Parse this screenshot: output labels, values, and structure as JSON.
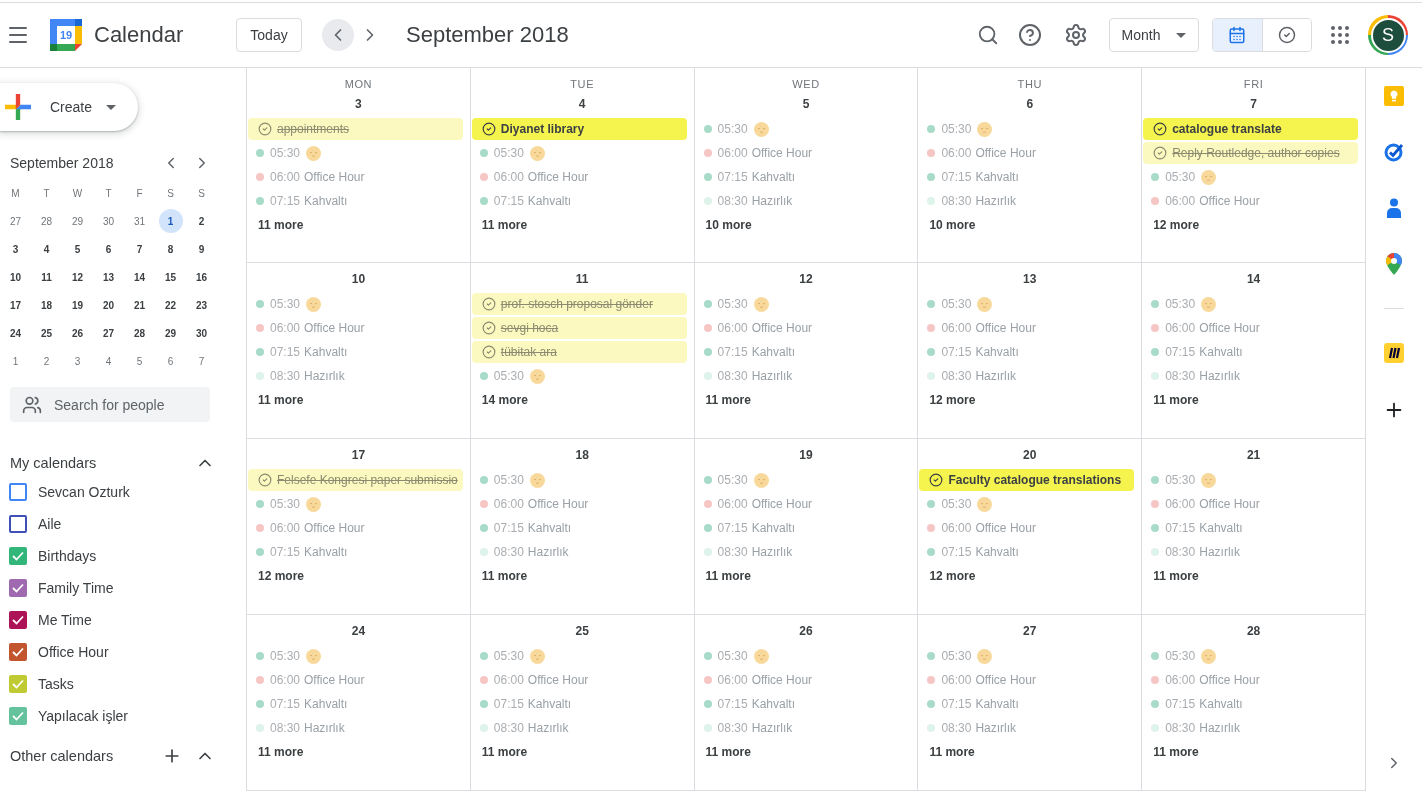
{
  "header": {
    "logo_text": "19",
    "app_name": "Calendar",
    "today_button": "Today",
    "nav": [
      {
        "kind": "prev",
        "hovered": true
      },
      {
        "kind": "next",
        "hovered": false
      }
    ],
    "title": "September 2018",
    "view_select": "Month",
    "view_toggle": [
      {
        "kind": "calendar",
        "selected": true
      },
      {
        "kind": "tasks",
        "selected": false
      }
    ],
    "avatar": "S"
  },
  "sidebar": {
    "create_button": "Create",
    "mini_calendar": {
      "title": "September 2018",
      "weekdays": [
        "M",
        "T",
        "W",
        "T",
        "F",
        "S",
        "S"
      ],
      "weeks": [
        [
          {
            "label": "27",
            "outside": true,
            "selected": false
          },
          {
            "label": "28",
            "outside": true,
            "selected": false
          },
          {
            "label": "29",
            "outside": true,
            "selected": false
          },
          {
            "label": "30",
            "outside": true,
            "selected": false
          },
          {
            "label": "31",
            "outside": true,
            "selected": false
          },
          {
            "label": "1",
            "outside": false,
            "selected": true
          },
          {
            "label": "2",
            "outside": false,
            "selected": false
          }
        ],
        [
          {
            "label": "3",
            "outside": false,
            "selected": false
          },
          {
            "label": "4",
            "outside": false,
            "selected": false
          },
          {
            "label": "5",
            "outside": false,
            "selected": false
          },
          {
            "label": "6",
            "outside": false,
            "selected": false
          },
          {
            "label": "7",
            "outside": false,
            "selected": false
          },
          {
            "label": "8",
            "outside": false,
            "selected": false
          },
          {
            "label": "9",
            "outside": false,
            "selected": false
          }
        ],
        [
          {
            "label": "10",
            "outside": false,
            "selected": false
          },
          {
            "label": "11",
            "outside": false,
            "selected": false
          },
          {
            "label": "12",
            "outside": false,
            "selected": false
          },
          {
            "label": "13",
            "outside": false,
            "selected": false
          },
          {
            "label": "14",
            "outside": false,
            "selected": false
          },
          {
            "label": "15",
            "outside": false,
            "selected": false
          },
          {
            "label": "16",
            "outside": false,
            "selected": false
          }
        ],
        [
          {
            "label": "17",
            "outside": false,
            "selected": false
          },
          {
            "label": "18",
            "outside": false,
            "selected": false
          },
          {
            "label": "19",
            "outside": false,
            "selected": false
          },
          {
            "label": "20",
            "outside": false,
            "selected": false
          },
          {
            "label": "21",
            "outside": false,
            "selected": false
          },
          {
            "label": "22",
            "outside": false,
            "selected": false
          },
          {
            "label": "23",
            "outside": false,
            "selected": false
          }
        ],
        [
          {
            "label": "24",
            "outside": false,
            "selected": false
          },
          {
            "label": "25",
            "outside": false,
            "selected": false
          },
          {
            "label": "26",
            "outside": false,
            "selected": false
          },
          {
            "label": "27",
            "outside": false,
            "selected": false
          },
          {
            "label": "28",
            "outside": false,
            "selected": false
          },
          {
            "label": "29",
            "outside": false,
            "selected": false
          },
          {
            "label": "30",
            "outside": false,
            "selected": false
          }
        ],
        [
          {
            "label": "1",
            "outside": true,
            "selected": false
          },
          {
            "label": "2",
            "outside": true,
            "selected": false
          },
          {
            "label": "3",
            "outside": true,
            "selected": false
          },
          {
            "label": "4",
            "outside": true,
            "selected": false
          },
          {
            "label": "5",
            "outside": true,
            "selected": false
          },
          {
            "label": "6",
            "outside": true,
            "selected": false
          },
          {
            "label": "7",
            "outside": true,
            "selected": false
          }
        ]
      ]
    },
    "search": {
      "placeholder": "Search for people"
    },
    "my_calendars": {
      "title": "My calendars",
      "expanded": true,
      "items": [
        {
          "name": "Sevcan Ozturk",
          "color": "#4285f4",
          "checked": false
        },
        {
          "name": "Aile",
          "color": "#3f51b5",
          "checked": false
        },
        {
          "name": "Birthdays",
          "color": "#33b679",
          "checked": true
        },
        {
          "name": "Family Time",
          "color": "#9e69af",
          "checked": true
        },
        {
          "name": "Me Time",
          "color": "#ad1457",
          "checked": true
        },
        {
          "name": "Office Hour",
          "color": "#c2552d",
          "checked": true
        },
        {
          "name": "Tasks",
          "color": "#c0ca33",
          "checked": true
        },
        {
          "name": "Yapılacak işler",
          "color": "#64c29c",
          "checked": true
        }
      ]
    },
    "other_calendars": {
      "title": "Other calendars",
      "expanded": true
    }
  },
  "grid": {
    "weekdays": [
      "MON",
      "TUE",
      "WED",
      "THU",
      "FRI"
    ],
    "weeks": [
      {
        "days": [
          {
            "date": "3",
            "events": [
              {
                "kind": "task",
                "title": "appointments",
                "done": true
              },
              {
                "kind": "emoji",
                "time": "05:30",
                "color": "#a8dcc9"
              },
              {
                "kind": "timed",
                "time": "06:00",
                "title": "Office Hour",
                "color": "#f5c6c4"
              },
              {
                "kind": "timed",
                "time": "07:15",
                "title": "Kahvaltı",
                "color": "#a8dcc9"
              }
            ],
            "more": "11 more"
          },
          {
            "date": "4",
            "events": [
              {
                "kind": "task",
                "title": "Diyanet library",
                "done": false
              },
              {
                "kind": "emoji",
                "time": "05:30",
                "color": "#a8dcc9"
              },
              {
                "kind": "timed",
                "time": "06:00",
                "title": "Office Hour",
                "color": "#f5c6c4"
              },
              {
                "kind": "timed",
                "time": "07:15",
                "title": "Kahvaltı",
                "color": "#a8dcc9"
              }
            ],
            "more": "11 more"
          },
          {
            "date": "5",
            "events": [
              {
                "kind": "emoji",
                "time": "05:30",
                "color": "#a8dcc9"
              },
              {
                "kind": "timed",
                "time": "06:00",
                "title": "Office Hour",
                "color": "#f5c6c4"
              },
              {
                "kind": "timed",
                "time": "07:15",
                "title": "Kahvaltı",
                "color": "#a8dcc9"
              },
              {
                "kind": "timed",
                "time": "08:30",
                "title": "Hazırlık",
                "color": "#def3ea"
              }
            ],
            "more": "10 more"
          },
          {
            "date": "6",
            "events": [
              {
                "kind": "emoji",
                "time": "05:30",
                "color": "#a8dcc9"
              },
              {
                "kind": "timed",
                "time": "06:00",
                "title": "Office Hour",
                "color": "#f5c6c4"
              },
              {
                "kind": "timed",
                "time": "07:15",
                "title": "Kahvaltı",
                "color": "#a8dcc9"
              },
              {
                "kind": "timed",
                "time": "08:30",
                "title": "Hazırlık",
                "color": "#def3ea"
              }
            ],
            "more": "10 more"
          },
          {
            "date": "7",
            "events": [
              {
                "kind": "task",
                "title": "catalogue translate",
                "done": false
              },
              {
                "kind": "task",
                "title": "Reply Routledge, author copies",
                "done": true
              },
              {
                "kind": "emoji",
                "time": "05:30",
                "color": "#a8dcc9"
              },
              {
                "kind": "timed",
                "time": "06:00",
                "title": "Office Hour",
                "color": "#f5c6c4"
              }
            ],
            "more": "12 more"
          }
        ]
      },
      {
        "days": [
          {
            "date": "10",
            "events": [
              {
                "kind": "emoji",
                "time": "05:30",
                "color": "#a8dcc9"
              },
              {
                "kind": "timed",
                "time": "06:00",
                "title": "Office Hour",
                "color": "#f5c6c4"
              },
              {
                "kind": "timed",
                "time": "07:15",
                "title": "Kahvaltı",
                "color": "#a8dcc9"
              },
              {
                "kind": "timed",
                "time": "08:30",
                "title": "Hazırlık",
                "color": "#def3ea"
              }
            ],
            "more": "11 more"
          },
          {
            "date": "11",
            "events": [
              {
                "kind": "task",
                "title": "prof. stosch proposal gönder",
                "done": true
              },
              {
                "kind": "task",
                "title": "sevgi hoca",
                "done": true
              },
              {
                "kind": "task",
                "title": "tübitak ara",
                "done": true
              },
              {
                "kind": "emoji",
                "time": "05:30",
                "color": "#a8dcc9"
              }
            ],
            "more": "14 more"
          },
          {
            "date": "12",
            "events": [
              {
                "kind": "emoji",
                "time": "05:30",
                "color": "#a8dcc9"
              },
              {
                "kind": "timed",
                "time": "06:00",
                "title": "Office Hour",
                "color": "#f5c6c4"
              },
              {
                "kind": "timed",
                "time": "07:15",
                "title": "Kahvaltı",
                "color": "#a8dcc9"
              },
              {
                "kind": "timed",
                "time": "08:30",
                "title": "Hazırlık",
                "color": "#def3ea"
              }
            ],
            "more": "11 more"
          },
          {
            "date": "13",
            "events": [
              {
                "kind": "emoji",
                "time": "05:30",
                "color": "#a8dcc9"
              },
              {
                "kind": "timed",
                "time": "06:00",
                "title": "Office Hour",
                "color": "#f5c6c4"
              },
              {
                "kind": "timed",
                "time": "07:15",
                "title": "Kahvaltı",
                "color": "#a8dcc9"
              },
              {
                "kind": "timed",
                "time": "08:30",
                "title": "Hazırlık",
                "color": "#def3ea"
              }
            ],
            "more": "12 more"
          },
          {
            "date": "14",
            "events": [
              {
                "kind": "emoji",
                "time": "05:30",
                "color": "#a8dcc9"
              },
              {
                "kind": "timed",
                "time": "06:00",
                "title": "Office Hour",
                "color": "#f5c6c4"
              },
              {
                "kind": "timed",
                "time": "07:15",
                "title": "Kahvaltı",
                "color": "#a8dcc9"
              },
              {
                "kind": "timed",
                "time": "08:30",
                "title": "Hazırlık",
                "color": "#def3ea"
              }
            ],
            "more": "11 more"
          }
        ]
      },
      {
        "days": [
          {
            "date": "17",
            "events": [
              {
                "kind": "task",
                "title": "Felsefe Kongresi paper submissio",
                "done": true
              },
              {
                "kind": "emoji",
                "time": "05:30",
                "color": "#a8dcc9"
              },
              {
                "kind": "timed",
                "time": "06:00",
                "title": "Office Hour",
                "color": "#f5c6c4"
              },
              {
                "kind": "timed",
                "time": "07:15",
                "title": "Kahvaltı",
                "color": "#a8dcc9"
              }
            ],
            "more": "12 more"
          },
          {
            "date": "18",
            "events": [
              {
                "kind": "emoji",
                "time": "05:30",
                "color": "#a8dcc9"
              },
              {
                "kind": "timed",
                "time": "06:00",
                "title": "Office Hour",
                "color": "#f5c6c4"
              },
              {
                "kind": "timed",
                "time": "07:15",
                "title": "Kahvaltı",
                "color": "#a8dcc9"
              },
              {
                "kind": "timed",
                "time": "08:30",
                "title": "Hazırlık",
                "color": "#def3ea"
              }
            ],
            "more": "11 more"
          },
          {
            "date": "19",
            "events": [
              {
                "kind": "emoji",
                "time": "05:30",
                "color": "#a8dcc9"
              },
              {
                "kind": "timed",
                "time": "06:00",
                "title": "Office Hour",
                "color": "#f5c6c4"
              },
              {
                "kind": "timed",
                "time": "07:15",
                "title": "Kahvaltı",
                "color": "#a8dcc9"
              },
              {
                "kind": "timed",
                "time": "08:30",
                "title": "Hazırlık",
                "color": "#def3ea"
              }
            ],
            "more": "11 more"
          },
          {
            "date": "20",
            "events": [
              {
                "kind": "task",
                "title": "Faculty catalogue translations",
                "done": false
              },
              {
                "kind": "emoji",
                "time": "05:30",
                "color": "#a8dcc9"
              },
              {
                "kind": "timed",
                "time": "06:00",
                "title": "Office Hour",
                "color": "#f5c6c4"
              },
              {
                "kind": "timed",
                "time": "07:15",
                "title": "Kahvaltı",
                "color": "#a8dcc9"
              }
            ],
            "more": "12 more"
          },
          {
            "date": "21",
            "events": [
              {
                "kind": "emoji",
                "time": "05:30",
                "color": "#a8dcc9"
              },
              {
                "kind": "timed",
                "time": "06:00",
                "title": "Office Hour",
                "color": "#f5c6c4"
              },
              {
                "kind": "timed",
                "time": "07:15",
                "title": "Kahvaltı",
                "color": "#a8dcc9"
              },
              {
                "kind": "timed",
                "time": "08:30",
                "title": "Hazırlık",
                "color": "#def3ea"
              }
            ],
            "more": "11 more"
          }
        ]
      },
      {
        "days": [
          {
            "date": "24",
            "events": [
              {
                "kind": "emoji",
                "time": "05:30",
                "color": "#a8dcc9"
              },
              {
                "kind": "timed",
                "time": "06:00",
                "title": "Office Hour",
                "color": "#f5c6c4"
              },
              {
                "kind": "timed",
                "time": "07:15",
                "title": "Kahvaltı",
                "color": "#a8dcc9"
              },
              {
                "kind": "timed",
                "time": "08:30",
                "title": "Hazırlık",
                "color": "#def3ea"
              }
            ],
            "more": "11 more"
          },
          {
            "date": "25",
            "events": [
              {
                "kind": "emoji",
                "time": "05:30",
                "color": "#a8dcc9"
              },
              {
                "kind": "timed",
                "time": "06:00",
                "title": "Office Hour",
                "color": "#f5c6c4"
              },
              {
                "kind": "timed",
                "time": "07:15",
                "title": "Kahvaltı",
                "color": "#a8dcc9"
              },
              {
                "kind": "timed",
                "time": "08:30",
                "title": "Hazırlık",
                "color": "#def3ea"
              }
            ],
            "more": "11 more"
          },
          {
            "date": "26",
            "events": [
              {
                "kind": "emoji",
                "time": "05:30",
                "color": "#a8dcc9"
              },
              {
                "kind": "timed",
                "time": "06:00",
                "title": "Office Hour",
                "color": "#f5c6c4"
              },
              {
                "kind": "timed",
                "time": "07:15",
                "title": "Kahvaltı",
                "color": "#a8dcc9"
              },
              {
                "kind": "timed",
                "time": "08:30",
                "title": "Hazırlık",
                "color": "#def3ea"
              }
            ],
            "more": "11 more"
          },
          {
            "date": "27",
            "events": [
              {
                "kind": "emoji",
                "time": "05:30",
                "color": "#a8dcc9"
              },
              {
                "kind": "timed",
                "time": "06:00",
                "title": "Office Hour",
                "color": "#f5c6c4"
              },
              {
                "kind": "timed",
                "time": "07:15",
                "title": "Kahvaltı",
                "color": "#a8dcc9"
              },
              {
                "kind": "timed",
                "time": "08:30",
                "title": "Hazırlık",
                "color": "#def3ea"
              }
            ],
            "more": "11 more"
          },
          {
            "date": "28",
            "events": [
              {
                "kind": "emoji",
                "time": "05:30",
                "color": "#a8dcc9"
              },
              {
                "kind": "timed",
                "time": "06:00",
                "title": "Office Hour",
                "color": "#f5c6c4"
              },
              {
                "kind": "timed",
                "time": "07:15",
                "title": "Kahvaltı",
                "color": "#a8dcc9"
              },
              {
                "kind": "timed",
                "time": "08:30",
                "title": "Hazırlık",
                "color": "#def3ea"
              }
            ],
            "more": "11 more"
          }
        ]
      }
    ]
  }
}
